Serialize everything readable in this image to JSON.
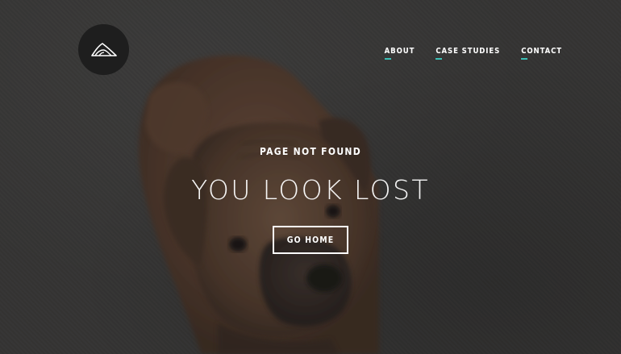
{
  "header": {
    "logo_icon": "mountain-logo-icon",
    "nav": [
      {
        "label": "ABOUT"
      },
      {
        "label": "CASE STUDIES"
      },
      {
        "label": "CONTACT"
      }
    ]
  },
  "hero": {
    "subtitle": "PAGE NOT FOUND",
    "headline": "YOU LOOK LOST",
    "button_label": "GO HOME"
  },
  "colors": {
    "accent": "#3bbfb6",
    "text": "#ffffff",
    "logo_bg": "#1e1e1e"
  },
  "background": {
    "subject": "boxer-dog-on-carpet"
  }
}
